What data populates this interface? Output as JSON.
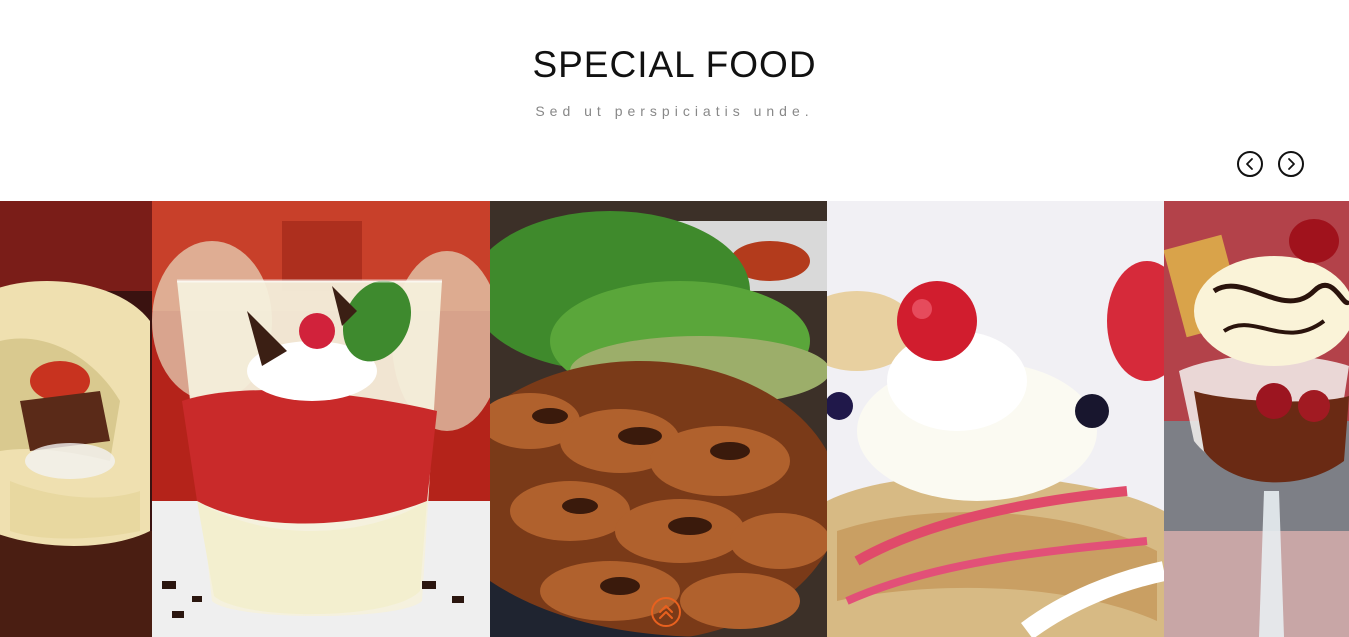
{
  "section": {
    "title": "SPECIAL FOOD",
    "subtitle": "Sed ut perspiciatis unde."
  },
  "carousel": {
    "prev_icon": "chevron-left-circle-icon",
    "next_icon": "chevron-right-circle-icon",
    "slides": [
      {
        "subject": "wrap"
      },
      {
        "subject": "berry-parfait"
      },
      {
        "subject": "grilled-chicken"
      },
      {
        "subject": "crepe-with-cream"
      },
      {
        "subject": "ice-cream-sundae"
      }
    ]
  },
  "scroll_top": {
    "icon": "double-chevron-up-icon"
  },
  "colors": {
    "accent": "#e8611f",
    "title": "#111111",
    "subtitle": "#888888"
  }
}
